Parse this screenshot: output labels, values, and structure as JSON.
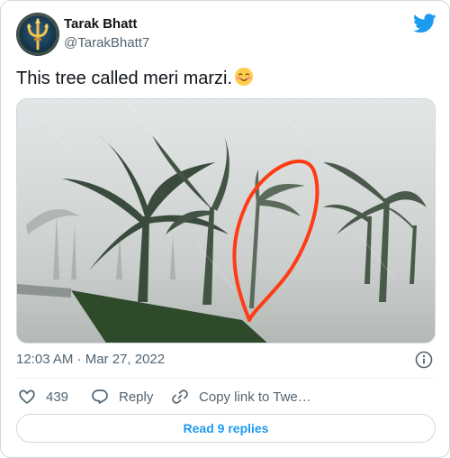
{
  "author": {
    "name": "Tarak Bhatt",
    "handle": "@TarakBhatt7"
  },
  "tweet": {
    "text": "This tree called meri marzi.",
    "emoji": "smiling-face-with-blush",
    "timestamp": "12:03 AM · Mar 27, 2022"
  },
  "actions": {
    "likes": "439",
    "reply_label": "Reply",
    "copy_link_label": "Copy link to Twe…"
  },
  "read_replies_label": "Read 9 replies",
  "colors": {
    "accent": "#1d9bf0",
    "secondary_text": "#536471",
    "annotation": "#ff3b14"
  },
  "icons": [
    "avatar-trident-icon",
    "twitter-bird-icon",
    "info-icon",
    "heart-icon",
    "reply-icon",
    "link-icon"
  ]
}
